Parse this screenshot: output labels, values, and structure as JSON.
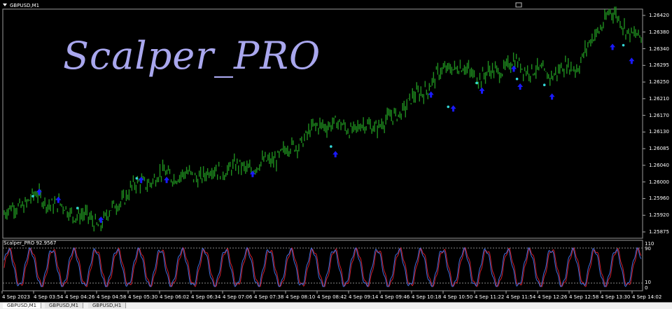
{
  "window": {
    "symbol_title": "GBPUSD,M1"
  },
  "brand": {
    "text": "Scalper_PRO"
  },
  "oscillator": {
    "title": "Scalper_PRO  92.9567",
    "levels": [
      "110",
      "90",
      "10",
      "0"
    ]
  },
  "price_axis": [
    "1.26420",
    "1.26380",
    "1.26340",
    "1.26295",
    "1.26250",
    "1.26210",
    "1.26170",
    "1.26130",
    "1.26085",
    "1.26040",
    "1.26000",
    "1.25960",
    "1.25920",
    "1.25875"
  ],
  "time_axis": [
    "4 Sep 2023",
    "4 Sep 03:54",
    "4 Sep 04:26",
    "4 Sep 04:58",
    "4 Sep 05:30",
    "4 Sep 06:02",
    "4 Sep 06:34",
    "4 Sep 07:06",
    "4 Sep 07:38",
    "4 Sep 08:10",
    "4 Sep 08:42",
    "4 Sep 09:14",
    "4 Sep 09:46",
    "4 Sep 10:18",
    "4 Sep 10:50",
    "4 Sep 11:22",
    "4 Sep 11:54",
    "4 Sep 12:26",
    "4 Sep 12:58",
    "4 Sep 13:30",
    "4 Sep 14:02"
  ],
  "tabs": [
    {
      "label": "GBPUSD,M1"
    },
    {
      "label": "GBPUSD,M1"
    },
    {
      "label": "GBPUSD,H1"
    }
  ],
  "colors": {
    "candles": "#1f8f1f",
    "osc_red": "#d21f2a",
    "osc_blue": "#3f6fe0",
    "arrow": "#1a1aff",
    "dot": "#33d6d6",
    "brand": "#a9a7ee"
  },
  "chart_data": {
    "type": "line",
    "title": "",
    "xlabel": "",
    "ylabel": "",
    "ylim": [
      1.25875,
      1.2642
    ],
    "x": [
      "4 Sep 2023",
      "4 Sep 03:54",
      "4 Sep 04:26",
      "4 Sep 04:58",
      "4 Sep 05:30",
      "4 Sep 06:02",
      "4 Sep 06:34",
      "4 Sep 07:06",
      "4 Sep 07:38",
      "4 Sep 08:10",
      "4 Sep 08:42",
      "4 Sep 09:14",
      "4 Sep 09:46",
      "4 Sep 10:18",
      "4 Sep 10:50",
      "4 Sep 11:22",
      "4 Sep 11:54",
      "4 Sep 12:26",
      "4 Sep 12:58",
      "4 Sep 13:30",
      "4 Sep 14:02"
    ],
    "series": [
      {
        "values": [
          1.2592,
          1.25965,
          1.2593,
          1.25895,
          1.25985,
          1.2602,
          1.26015,
          1.26035,
          1.2604,
          1.26085,
          1.2615,
          1.26135,
          1.2615,
          1.2622,
          1.26295,
          1.26265,
          1.263,
          1.2627,
          1.26295,
          1.2643,
          1.26355
        ]
      }
    ],
    "oscillator": {
      "ylim": [
        0,
        110
      ],
      "levels": [
        10,
        90
      ]
    }
  }
}
